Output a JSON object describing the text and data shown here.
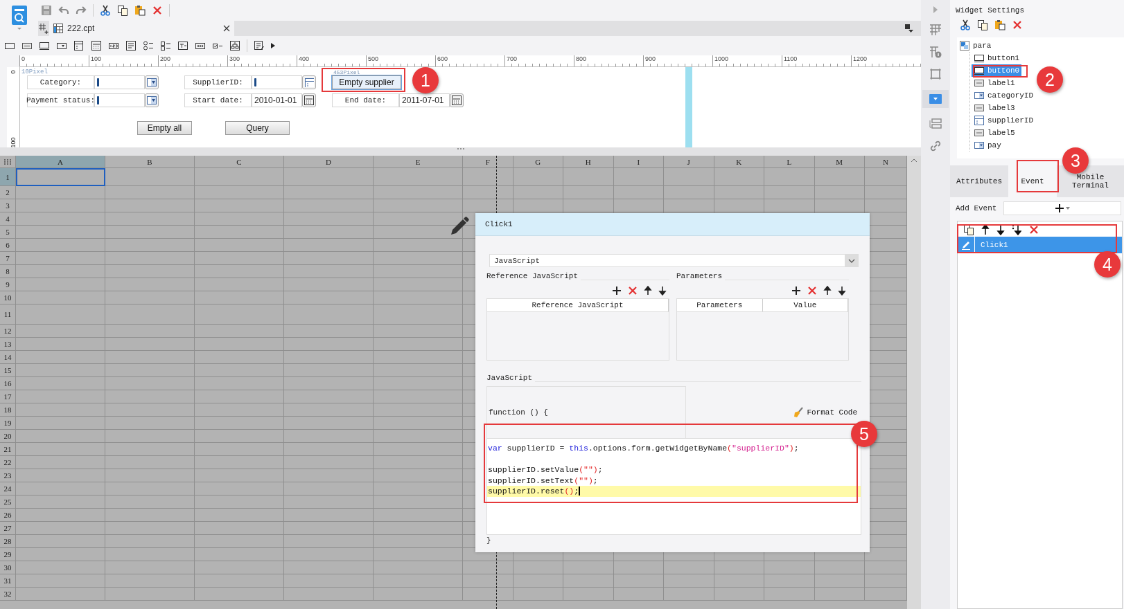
{
  "file_tabs": [
    {
      "label": "222.cpt",
      "selected": true
    }
  ],
  "designer": {
    "ruler_marks": [
      "0",
      "100",
      "200",
      "300",
      "400",
      "500",
      "600",
      "700",
      "800",
      "900",
      "1000",
      "1100",
      "1200"
    ],
    "vertical_ruler_marks": [
      "0",
      "100"
    ],
    "margin_hint": "10Pixel",
    "width_hint": "453Pixel",
    "rows": [
      {
        "kind": "fields",
        "groups": [
          {
            "label": "Category:",
            "control": {
              "kind": "combo"
            }
          },
          {
            "label": "SupplierID:",
            "control": {
              "kind": "tree"
            }
          },
          {
            "control": {
              "kind": "button",
              "label": "Empty supplier",
              "selected": true
            }
          }
        ]
      },
      {
        "kind": "fields",
        "groups": [
          {
            "label": "Payment status:",
            "control": {
              "kind": "combo"
            }
          },
          {
            "label": "Start date:",
            "control": {
              "kind": "date",
              "value": "2010-01-01"
            }
          },
          {
            "label": "End date:",
            "control": {
              "kind": "date",
              "value": "2011-07-01"
            }
          }
        ]
      },
      {
        "kind": "buttons",
        "buttons": [
          {
            "label": "Empty all",
            "selected": false
          },
          {
            "label": "Query",
            "selected": false
          }
        ]
      }
    ]
  },
  "sheet": {
    "columns": [
      {
        "label": "A",
        "selected": true
      },
      {
        "label": "B",
        "selected": false
      },
      {
        "label": "C",
        "selected": false
      },
      {
        "label": "D",
        "selected": false
      },
      {
        "label": "E",
        "selected": false
      },
      {
        "label": "F",
        "selected": false
      },
      {
        "label": "G",
        "selected": false
      },
      {
        "label": "H",
        "selected": false
      },
      {
        "label": "I",
        "selected": false
      },
      {
        "label": "J",
        "selected": false
      },
      {
        "label": "K",
        "selected": false
      },
      {
        "label": "L",
        "selected": false
      },
      {
        "label": "M",
        "selected": false
      },
      {
        "label": "N",
        "selected": false
      }
    ],
    "rows": [
      {
        "label": "1",
        "selected": true
      },
      {
        "label": "2",
        "selected": false
      },
      {
        "label": "3",
        "selected": false
      },
      {
        "label": "4",
        "selected": false
      },
      {
        "label": "5",
        "selected": false
      },
      {
        "label": "6",
        "selected": false
      },
      {
        "label": "7",
        "selected": false
      },
      {
        "label": "8",
        "selected": false
      },
      {
        "label": "9",
        "selected": false
      },
      {
        "label": "10",
        "selected": false
      },
      {
        "label": "11",
        "selected": false
      },
      {
        "label": "12",
        "selected": false
      },
      {
        "label": "13",
        "selected": false
      },
      {
        "label": "14",
        "selected": false
      },
      {
        "label": "15",
        "selected": false
      },
      {
        "label": "16",
        "selected": false
      },
      {
        "label": "17",
        "selected": false
      },
      {
        "label": "18",
        "selected": false
      },
      {
        "label": "19",
        "selected": false
      },
      {
        "label": "20",
        "selected": false
      },
      {
        "label": "21",
        "selected": false
      },
      {
        "label": "22",
        "selected": false
      },
      {
        "label": "23",
        "selected": false
      },
      {
        "label": "24",
        "selected": false
      },
      {
        "label": "25",
        "selected": false
      },
      {
        "label": "26",
        "selected": false
      },
      {
        "label": "27",
        "selected": false
      },
      {
        "label": "28",
        "selected": false
      },
      {
        "label": "29",
        "selected": false
      },
      {
        "label": "30",
        "selected": false
      },
      {
        "label": "31",
        "selected": false
      },
      {
        "label": "32",
        "selected": false
      }
    ]
  },
  "event_dialog": {
    "title": "Click1",
    "script_type": "JavaScript",
    "reference_section": {
      "title": "Reference JavaScript",
      "columns": [
        "Reference JavaScript"
      ]
    },
    "parameters_section": {
      "title": "Parameters",
      "columns": [
        "Parameters",
        "Value"
      ]
    },
    "script_section": {
      "title": "JavaScript",
      "header": "function () {",
      "format_button": "Format Code",
      "footer": "}",
      "lines": [
        {
          "kind": "code",
          "current": false,
          "tokens": [
            {
              "kind": "keyword",
              "text": "var"
            },
            {
              "kind": "plain",
              "text": " supplierID = "
            },
            {
              "kind": "keyword",
              "text": "this"
            },
            {
              "kind": "plain",
              "text": ".options.form.getWidgetByName"
            },
            {
              "kind": "punct",
              "text": "("
            },
            {
              "kind": "string",
              "text": "\"supplierID\""
            },
            {
              "kind": "punct",
              "text": ")"
            },
            {
              "kind": "plain",
              "text": ";"
            }
          ]
        },
        {
          "kind": "blank"
        },
        {
          "kind": "code",
          "current": false,
          "tokens": [
            {
              "kind": "plain",
              "text": "supplierID.setValue"
            },
            {
              "kind": "punct",
              "text": "(\"\")"
            },
            {
              "kind": "plain",
              "text": ";"
            }
          ]
        },
        {
          "kind": "code",
          "current": false,
          "tokens": [
            {
              "kind": "plain",
              "text": "supplierID.setText"
            },
            {
              "kind": "punct",
              "text": "(\"\")"
            },
            {
              "kind": "plain",
              "text": ";"
            }
          ]
        },
        {
          "kind": "code",
          "current": true,
          "tokens": [
            {
              "kind": "plain",
              "text": "supplierID.reset"
            },
            {
              "kind": "punct",
              "text": "()"
            },
            {
              "kind": "plain",
              "text": ";"
            }
          ]
        }
      ]
    }
  },
  "widget_settings": {
    "title": "Widget Settings",
    "tree": {
      "name": "para",
      "kind": "form",
      "selected": false,
      "children": [
        {
          "name": "button1",
          "kind": "button",
          "selected": false
        },
        {
          "name": "button0",
          "kind": "button",
          "selected": true
        },
        {
          "name": "label1",
          "kind": "label",
          "selected": false
        },
        {
          "name": "categoryID",
          "kind": "combo",
          "selected": false
        },
        {
          "name": "label3",
          "kind": "label",
          "selected": false
        },
        {
          "name": "supplierID",
          "kind": "tree",
          "selected": false
        },
        {
          "name": "label5",
          "kind": "label",
          "selected": false
        },
        {
          "name": "pay",
          "kind": "combo",
          "selected": false
        }
      ]
    },
    "tabs": [
      {
        "label": "Attributes",
        "selected": false
      },
      {
        "label": "Event",
        "selected": true
      },
      {
        "label": "Mobile Terminal",
        "selected": false
      }
    ],
    "add_event_label": "Add Event",
    "events": [
      {
        "name": "Click1",
        "selected": true
      }
    ]
  },
  "callouts": [
    {
      "number": "1"
    },
    {
      "number": "2"
    },
    {
      "number": "3"
    },
    {
      "number": "4"
    },
    {
      "number": "5"
    }
  ]
}
